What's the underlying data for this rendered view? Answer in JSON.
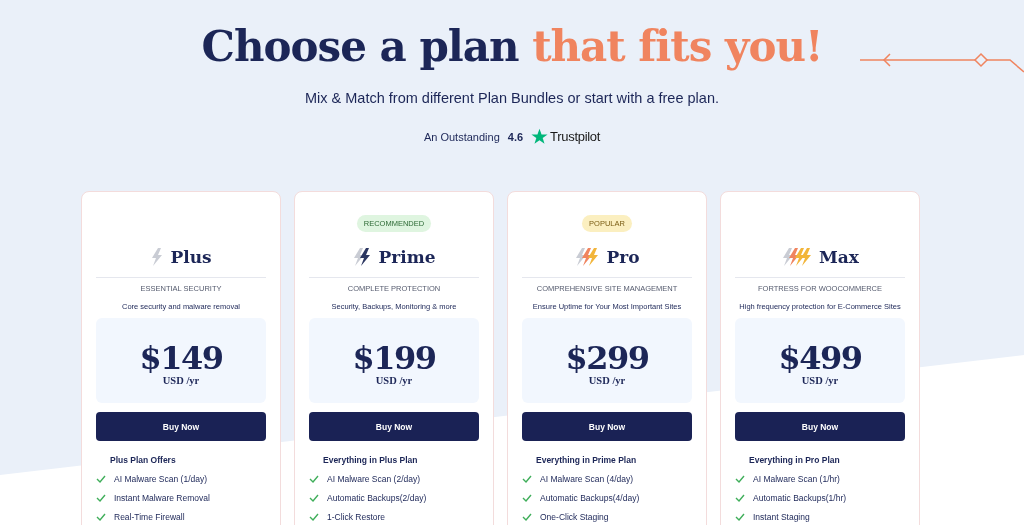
{
  "header": {
    "title_start": "Choose a plan",
    "title_highlight": "that fits you!",
    "subtitle": "Mix & Match from different Plan Bundles or start with a free plan.",
    "rating_label": "An Outstanding",
    "rating_score": "4.6",
    "rating_brand": "Trustpilot"
  },
  "plans": [
    {
      "name": "Plus",
      "category": "ESSENTIAL SECURITY",
      "tagline": "Core security and malware removal",
      "price": "$149",
      "period": "USD /yr",
      "button": "Buy Now",
      "features_title": "Plus Plan Offers",
      "features": [
        "AI Malware Scan (1/day)",
        "Instant Malware Removal",
        "Real-Time Firewall"
      ]
    },
    {
      "badge": {
        "text": "RECOMMENDED",
        "kind": "recommended"
      },
      "name": "Prime",
      "category": "COMPLETE PROTECTION",
      "tagline": "Security, Backups, Monitoring & more",
      "price": "$199",
      "period": "USD /yr",
      "button": "Buy Now",
      "features_title": "Everything in Plus Plan",
      "features": [
        "AI Malware Scan (2/day)",
        "Automatic Backups(2/day)",
        "1-Click Restore"
      ]
    },
    {
      "badge": {
        "text": "POPULAR",
        "kind": "popular"
      },
      "name": "Pro",
      "category": "COMPREHENSIVE SITE MANAGEMENT",
      "tagline": "Ensure Uptime for Your Most Important Sites",
      "price": "$299",
      "period": "USD /yr",
      "button": "Buy Now",
      "features_title": "Everything in Prime Plan",
      "features": [
        "AI Malware Scan (4/day)",
        "Automatic Backups(4/day)",
        "One-Click Staging"
      ]
    },
    {
      "name": "Max",
      "category": "FORTRESS FOR WOOCOMMERCE",
      "tagline": "High frequency protection for E-Commerce Sites",
      "price": "$499",
      "period": "USD /yr",
      "button": "Buy Now",
      "features_title": "Everything in Pro Plan",
      "features": [
        "AI Malware Scan (1/hr)",
        "Automatic Backups(1/hr)",
        "Instant Staging"
      ]
    }
  ]
}
